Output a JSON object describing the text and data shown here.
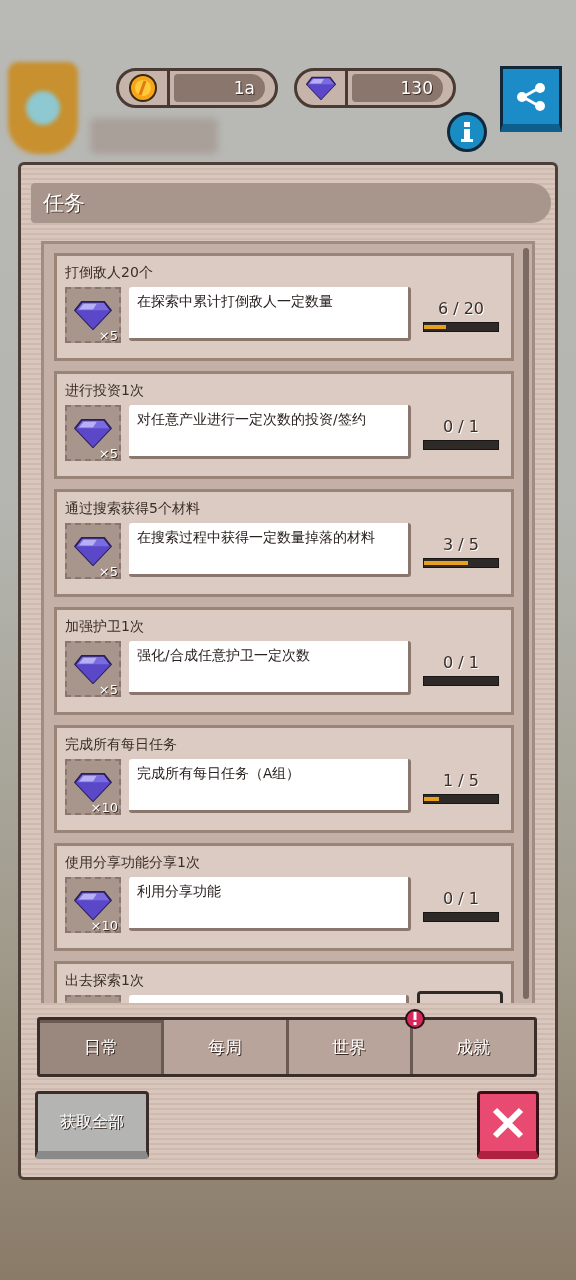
{
  "currencies": [
    {
      "kind": "coin",
      "value": "1a"
    },
    {
      "kind": "gem",
      "value": "130"
    }
  ],
  "panel": {
    "title": "任务"
  },
  "quests": [
    {
      "title": "打倒敌人20个",
      "reward": "×5",
      "description": "在探索中累计打倒敌人一定数量",
      "progress": "6 / 20",
      "level": 0.3
    },
    {
      "title": "进行投资1次",
      "reward": "×5",
      "description": "对任意产业进行一定次数的投资/签约",
      "progress": "0 / 1",
      "level": 0
    },
    {
      "title": "通过搜索获得5个材料",
      "reward": "×5",
      "description": "在搜索过程中获得一定数量掉落的材料",
      "progress": "3 / 5",
      "level": 0.6
    },
    {
      "title": "加强护卫1次",
      "reward": "×5",
      "description": "强化/合成任意护卫一定次数",
      "progress": "0 / 1",
      "level": 0
    },
    {
      "title": "完成所有每日任务",
      "reward": "×10",
      "description": "完成所有每日任务（A组）",
      "progress": "1 / 5",
      "level": 0.2
    },
    {
      "title": "使用分享功能分享1次",
      "reward": "×10",
      "description": "利用分享功能",
      "progress": "0 / 1",
      "level": 0
    },
    {
      "title": "出去探索1次"
    }
  ],
  "tabs": [
    {
      "label": "日常",
      "selected": true,
      "alert": false
    },
    {
      "label": "每周",
      "selected": false,
      "alert": false
    },
    {
      "label": "世界",
      "selected": false,
      "alert": false
    },
    {
      "label": "成就",
      "selected": false,
      "alert": true
    }
  ],
  "buttons": {
    "claim_all": "获取全部"
  }
}
